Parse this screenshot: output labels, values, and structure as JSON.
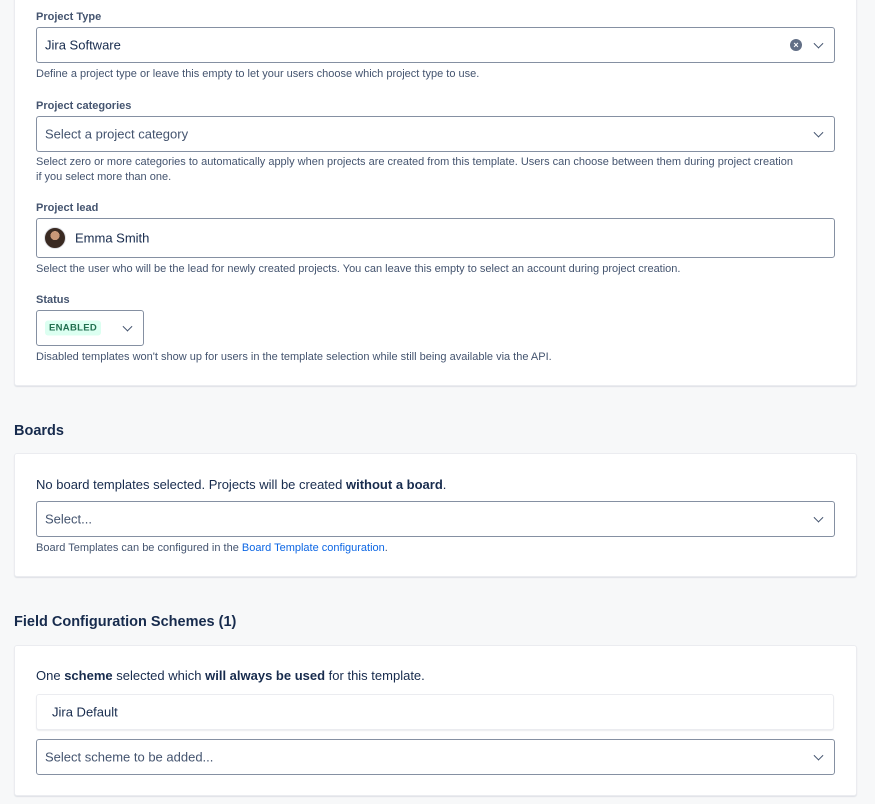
{
  "project_type": {
    "label": "Project Type",
    "value": "Jira Software",
    "help": "Define a project type or leave this empty to let your users choose which project type to use."
  },
  "project_categories": {
    "label": "Project categories",
    "placeholder": "Select a project category",
    "help_line1": "Select zero or more categories to automatically apply when projects are created from this template. Users can choose between them during project creation",
    "help_line2": "if you select more than one."
  },
  "project_lead": {
    "label": "Project lead",
    "value": "Emma Smith",
    "help": "Select the user who will be the lead for newly created projects. You can leave this empty to select an account during project creation."
  },
  "status": {
    "label": "Status",
    "value": "ENABLED",
    "help": "Disabled templates won't show up for users in the template selection while still being available via the API."
  },
  "boards": {
    "heading": "Boards",
    "info_prefix": "No board templates selected. Projects will be created ",
    "info_bold": "without a board",
    "info_suffix": ".",
    "placeholder": "Select...",
    "help_prefix": "Board Templates can be configured in the ",
    "help_link": "Board Template configuration",
    "help_suffix": "."
  },
  "field_config": {
    "heading": "Field Configuration Schemes (1)",
    "info_1": "One ",
    "info_2": "scheme",
    "info_3": " selected which ",
    "info_4": "will always be used",
    "info_5": " for this template.",
    "schemes": [
      "Jira Default"
    ],
    "placeholder": "Select scheme to be added..."
  },
  "colors": {
    "link": "#0c66e4",
    "lozenge_bg": "#dcfff1",
    "lozenge_text": "#216e4e"
  }
}
